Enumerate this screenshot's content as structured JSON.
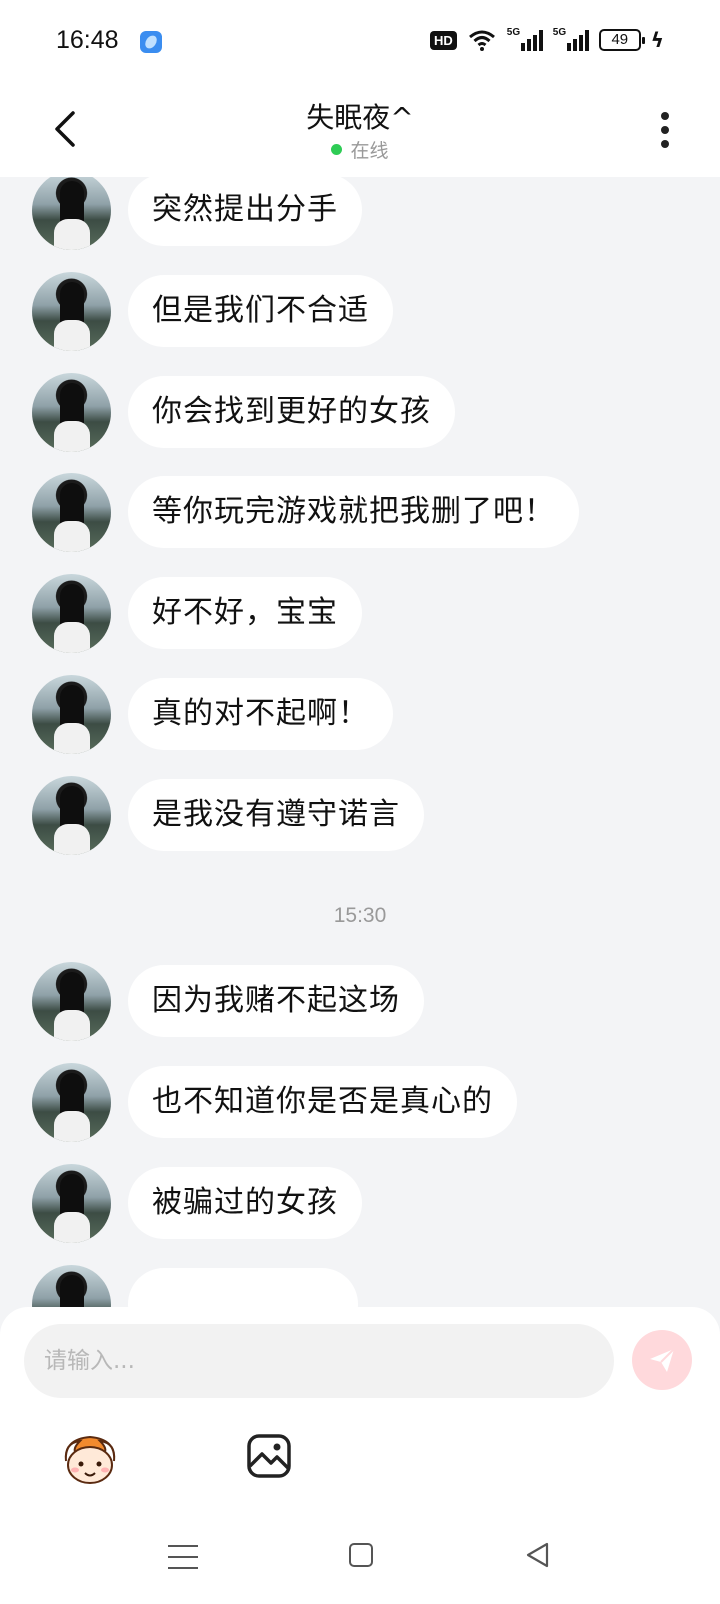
{
  "status_bar": {
    "time": "16:48",
    "hd_label": "HD",
    "signal_label_1": "5G",
    "signal_label_2": "5G",
    "battery": "49",
    "icons": [
      "app-icon",
      "wifi-icon",
      "signal-icon",
      "battery-icon",
      "charging-icon"
    ]
  },
  "header": {
    "title": "失眠夜^",
    "status_text": "在线",
    "status_color": "#2ecc55",
    "back_icon": "chevron-left-icon",
    "more_icon": "more-vertical-icon"
  },
  "messages_group_1": [
    {
      "text": "突然提出分手"
    },
    {
      "text": "但是我们不合适"
    },
    {
      "text": "你会找到更好的女孩"
    },
    {
      "text": "等你玩完游戏就把我删了吧！"
    },
    {
      "text": "好不好，宝宝"
    },
    {
      "text": "真的对不起啊！"
    },
    {
      "text": "是我没有遵守诺言"
    }
  ],
  "timestamp": "15:30",
  "messages_group_2": [
    {
      "text": "因为我赌不起这场"
    },
    {
      "text": "也不知道你是否是真心的"
    },
    {
      "text": "被骗过的女孩"
    },
    {
      "text": ""
    }
  ],
  "composer": {
    "placeholder": "请输入...",
    "send_icon": "send-icon",
    "send_color": "#ffd9dc",
    "emoji_icon": "mascot-emoji-icon",
    "image_icon": "image-icon"
  },
  "nav_bar": {
    "icons": [
      "menu-icon",
      "home-icon",
      "back-triangle-icon"
    ]
  }
}
